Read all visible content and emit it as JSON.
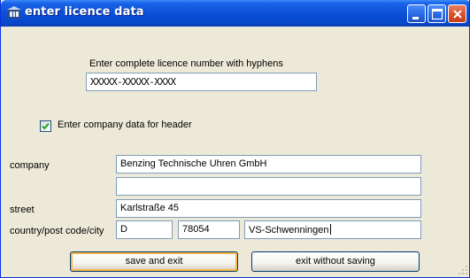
{
  "window": {
    "title": "enter licence data",
    "title_icon": "app-icon"
  },
  "licence": {
    "label": "Enter complete licence number with hyphens",
    "value": "XXXXX-XXXXX-XXXX"
  },
  "company_header": {
    "label": "Enter company data for header",
    "checked": true
  },
  "fields": {
    "company_label": "company",
    "company_value": "Benzing Technische Uhren GmbH",
    "company2_value": "",
    "street_label": "street",
    "street_value": "Karlstraße 45",
    "location_label": "country/post code/city",
    "country_value": "D",
    "postcode_value": "78054",
    "city_value": "VS-Schwenningen"
  },
  "buttons": {
    "save_label": "save and exit",
    "exit_label": "exit without saving"
  },
  "colors": {
    "titlebar": "#0a50d8",
    "face": "#ece9d8",
    "input_border": "#7f9db9",
    "default_button_highlight": "#f8b646",
    "close_button": "#d8502c"
  }
}
